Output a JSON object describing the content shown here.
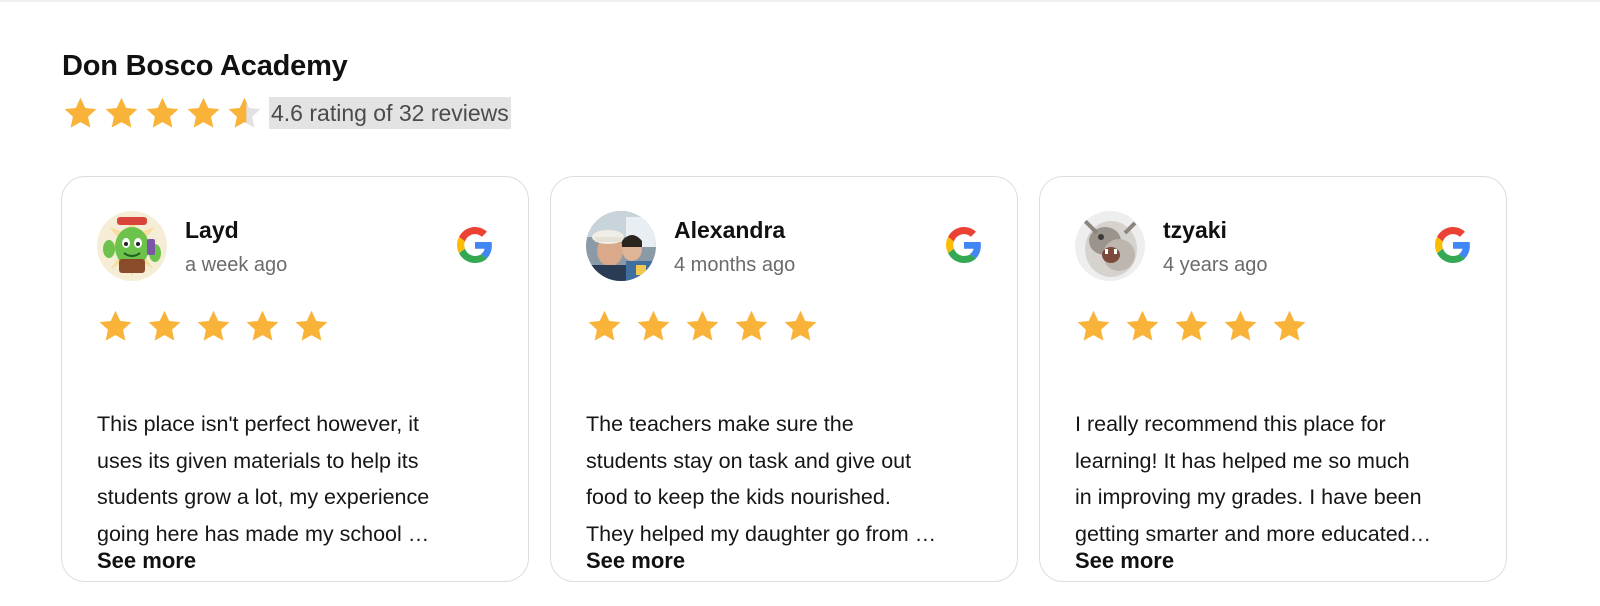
{
  "place": {
    "title": "Don Bosco Academy",
    "rating": 4.6,
    "rating_text": "4.6 rating of 32 reviews",
    "star_color": "#f9b339"
  },
  "reviews": [
    {
      "author": "Layd",
      "time": "a week ago",
      "stars": 5,
      "text_lines": [
        "This place isn't perfect however, it",
        "uses its given materials to help its",
        "students grow a lot, my experience",
        "going here has made my school …"
      ],
      "see_more": "See more",
      "avatar_icon": "cactus-character-avatar",
      "source_icon": "google-icon"
    },
    {
      "author": "Alexandra",
      "time": "4 months ago",
      "stars": 5,
      "text_lines": [
        "The teachers make sure the",
        "students stay on task and give out",
        "food to keep the kids nourished.",
        "They helped my daughter go from  …"
      ],
      "see_more": "See more",
      "avatar_icon": "photo-avatar",
      "source_icon": "google-icon"
    },
    {
      "author": "tzyaki",
      "time": "4 years ago",
      "stars": 5,
      "text_lines": [
        "I really recommend this place for",
        "learning! It has helped me so much",
        "in improving my grades. I have been",
        "getting smarter and more educated…"
      ],
      "see_more": "See more",
      "avatar_icon": "cat-photo-avatar",
      "source_icon": "google-icon"
    }
  ]
}
